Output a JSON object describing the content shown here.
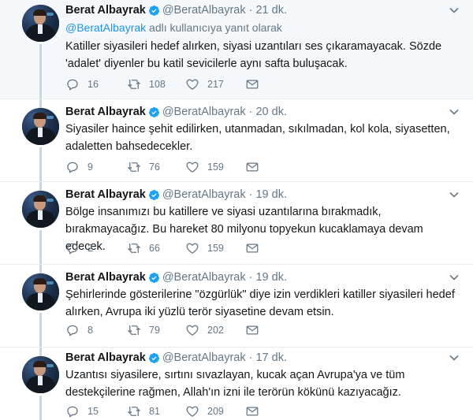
{
  "account": {
    "name": "Berat Albayrak",
    "handle": "@BeratAlbayrak"
  },
  "reply_context": {
    "mention": "@BeratAlbayrak",
    "suffix": " adlı kullanıcıya yanıt olarak"
  },
  "tweets": [
    {
      "time": "21 dk.",
      "text": "Katiller siyasileri hedef alırken, siyasi uzantıları ses çıkaramayacak. Sözde 'adalet' diyenler bu katil sevicilerle aynı safta buluşacak.",
      "replies": "16",
      "retweets": "108",
      "likes": "217"
    },
    {
      "time": "20 dk.",
      "text": "Siyasiler haince şehit edilirken, utanmadan, sıkılmadan, kol kola, siyasetten, adaletten bahsedecekler.",
      "replies": "9",
      "retweets": "76",
      "likes": "159"
    },
    {
      "time": "19 dk.",
      "text": "Bölge insanımızı bu katillere ve siyasi uzantılarına bırakmadık, bırakmayacağız. Bu hareket 80 milyonu topyekun kucaklamaya devam edecek.",
      "replies": "2",
      "retweets": "66",
      "likes": "159"
    },
    {
      "time": "19 dk.",
      "text": "Şehirlerinde gösterilerine \"özgürlük\" diye izin verdikleri katiller siyasileri hedef alırken, Avrupa iki yüzlü terör siyasetine devam etsin.",
      "replies": "8",
      "retweets": "79",
      "likes": "202"
    },
    {
      "time": "17 dk.",
      "text": "Uzantısı siyasilere, sırtını sıvazlayan, kucak açan Avrupa'ya ve tüm destekçilerine rağmen, Allah'ın izni ile terörün kökünü kazıyacağız.",
      "replies": "15",
      "retweets": "81",
      "likes": "209"
    }
  ],
  "colors": {
    "link": "#1b95e0",
    "verified": "#1da1f2",
    "muted": "#657786",
    "thread_line": "#ccd6dd"
  },
  "icons": {
    "reply": "reply-icon",
    "retweet": "retweet-icon",
    "like": "heart-icon",
    "dm": "envelope-icon",
    "menu": "chevron-down-icon",
    "verified": "verified-badge-icon"
  }
}
